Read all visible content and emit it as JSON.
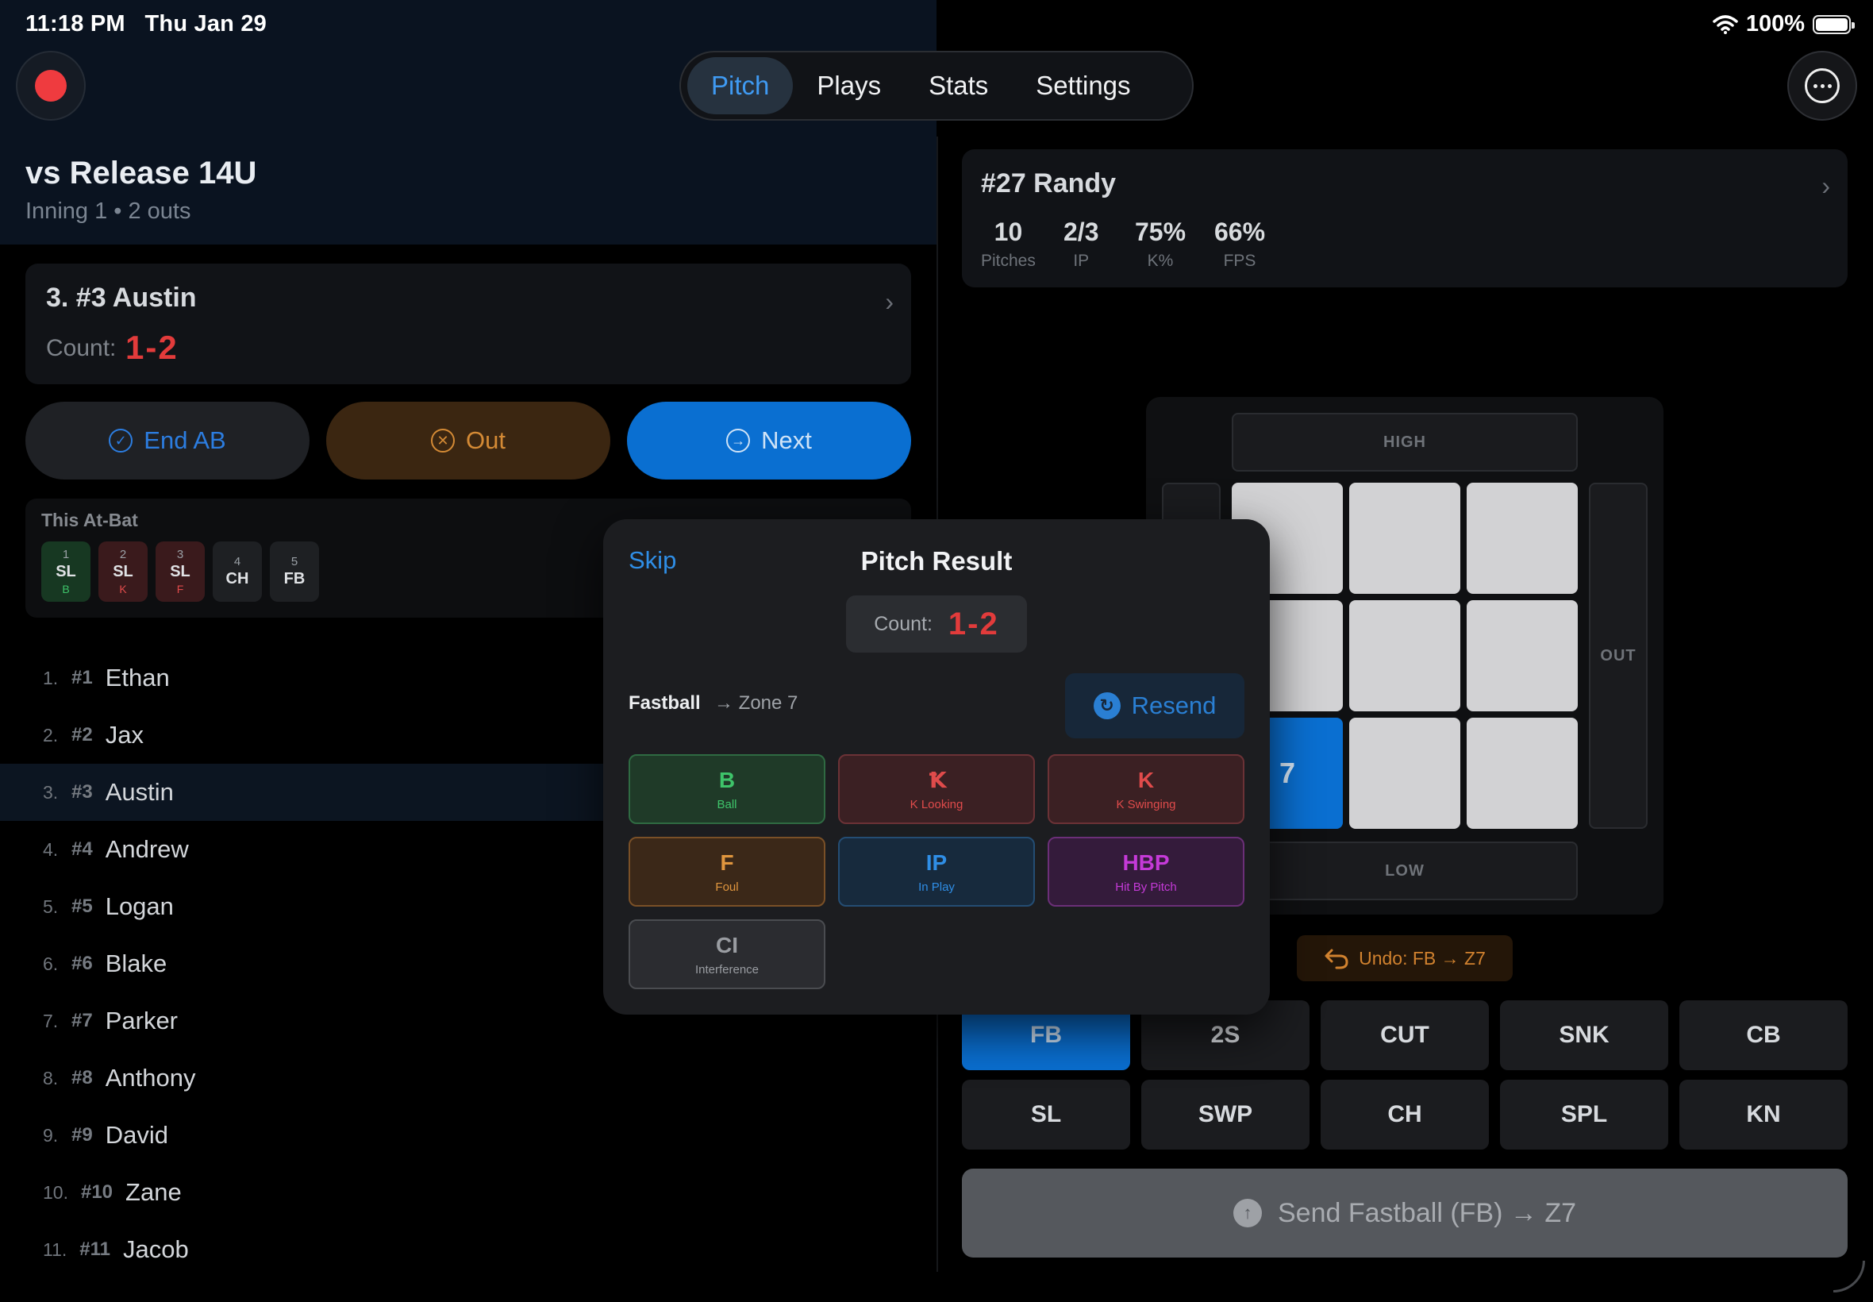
{
  "status_bar": {
    "time": "11:18 PM",
    "date": "Thu Jan 29",
    "battery": "100%",
    "battery_level": 1.0,
    "wifi_icon": "wifi-icon"
  },
  "tabs": [
    {
      "label": "Pitch",
      "active": true
    },
    {
      "label": "Plays",
      "active": false
    },
    {
      "label": "Stats",
      "active": false
    },
    {
      "label": "Settings",
      "active": false
    }
  ],
  "game": {
    "title": "vs Release 14U",
    "subtitle": "Inning 1 • 2 outs"
  },
  "batter": {
    "name": "3. #3 Austin",
    "count_label": "Count:",
    "count": "1-2"
  },
  "actions": {
    "end_ab": "End AB",
    "out": "Out",
    "next": "Next"
  },
  "at_bat": {
    "title": "This At-Bat",
    "pitches": [
      {
        "num": "1",
        "type": "SL",
        "result": "B",
        "color": "green"
      },
      {
        "num": "2",
        "type": "SL",
        "result": "K",
        "color": "red"
      },
      {
        "num": "3",
        "type": "SL",
        "result": "F",
        "color": "red"
      },
      {
        "num": "4",
        "type": "CH",
        "result": "",
        "color": "gray"
      },
      {
        "num": "5",
        "type": "FB",
        "result": "",
        "color": "gray"
      }
    ]
  },
  "lineup": [
    {
      "idx": "1.",
      "num": "#1",
      "name": "Ethan",
      "active": false
    },
    {
      "idx": "2.",
      "num": "#2",
      "name": "Jax",
      "active": false
    },
    {
      "idx": "3.",
      "num": "#3",
      "name": "Austin",
      "active": true
    },
    {
      "idx": "4.",
      "num": "#4",
      "name": "Andrew",
      "active": false
    },
    {
      "idx": "5.",
      "num": "#5",
      "name": "Logan",
      "active": false
    },
    {
      "idx": "6.",
      "num": "#6",
      "name": "Blake",
      "active": false
    },
    {
      "idx": "7.",
      "num": "#7",
      "name": "Parker",
      "active": false
    },
    {
      "idx": "8.",
      "num": "#8",
      "name": "Anthony",
      "active": false
    },
    {
      "idx": "9.",
      "num": "#9",
      "name": "David",
      "active": false
    },
    {
      "idx": "10.",
      "num": "#10",
      "name": "Zane",
      "active": false
    },
    {
      "idx": "11.",
      "num": "#11",
      "name": "Jacob",
      "active": false
    }
  ],
  "pitcher": {
    "name": "#27 Randy",
    "stats": [
      {
        "value": "10",
        "label": "Pitches"
      },
      {
        "value": "2/3",
        "label": "IP"
      },
      {
        "value": "75%",
        "label": "K%"
      },
      {
        "value": "66%",
        "label": "FPS"
      }
    ]
  },
  "zone": {
    "high": "HIGH",
    "low": "LOW",
    "out": "OUT",
    "selected_label": "7"
  },
  "undo": {
    "label": "Undo: FB → Z7"
  },
  "pitch_types": [
    {
      "code": "FB",
      "selected": true
    },
    {
      "code": "2S",
      "selected": false
    },
    {
      "code": "CUT",
      "selected": false
    },
    {
      "code": "SNK",
      "selected": false
    },
    {
      "code": "CB",
      "selected": false
    },
    {
      "code": "SL",
      "selected": false
    },
    {
      "code": "SWP",
      "selected": false
    },
    {
      "code": "CH",
      "selected": false
    },
    {
      "code": "SPL",
      "selected": false
    },
    {
      "code": "KN",
      "selected": false
    }
  ],
  "send": {
    "label": "Send Fastball (FB) → Z7"
  },
  "modal": {
    "skip": "Skip",
    "title": "Pitch Result",
    "count_label": "Count:",
    "count": "1-2",
    "pitch": "Fastball",
    "zone": "→ Zone 7",
    "resend": "Resend",
    "results": [
      {
        "code": "B",
        "label": "Ball",
        "color": "#3ec46a",
        "bg": "#1f3a28",
        "border": "#2f6a42"
      },
      {
        "code": "Ꝁ",
        "label": "K Looking",
        "color": "#e04b4b",
        "bg": "#3b2023",
        "border": "#6b3236"
      },
      {
        "code": "K",
        "label": "K Swinging",
        "color": "#e04b4b",
        "bg": "#3b2023",
        "border": "#6b3236"
      },
      {
        "code": "F",
        "label": "Foul",
        "color": "#e0963e",
        "bg": "#3b2818",
        "border": "#7a5027"
      },
      {
        "code": "IP",
        "label": "In Play",
        "color": "#2f8ee6",
        "bg": "#172a3d",
        "border": "#244d73"
      },
      {
        "code": "HBP",
        "label": "Hit By Pitch",
        "color": "#c53ad8",
        "bg": "#341b3b",
        "border": "#6b2f78"
      },
      {
        "code": "CI",
        "label": "Interference",
        "color": "#9a9da2",
        "bg": "#2b2c30",
        "border": "#4a4c50"
      }
    ]
  }
}
